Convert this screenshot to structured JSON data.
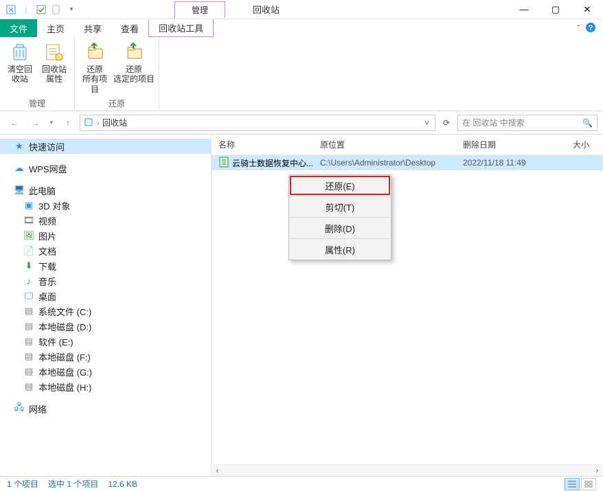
{
  "titlebar": {
    "contextual_label": "管理",
    "window_title": "回收站"
  },
  "tabs": {
    "file": "文件",
    "home": "主页",
    "share": "共享",
    "view": "查看",
    "contextual": "回收站工具"
  },
  "ribbon": {
    "group_manage": "管理",
    "group_restore": "还原",
    "empty_bin": "清空回\n收站",
    "properties": "回收站\n属性",
    "restore_all": "还原\n所有项目",
    "restore_selected": "还原\n选定的项目"
  },
  "address": {
    "location": "回收站"
  },
  "search": {
    "placeholder": "在 回收站 中搜索"
  },
  "columns": {
    "name": "名称",
    "original_location": "原位置",
    "deleted_date": "删除日期",
    "size": "大小"
  },
  "items": [
    {
      "name": "云骑士数据恢复中心...",
      "original_location": "C:\\Users\\Administrator\\Desktop",
      "deleted_date": "2022/11/18 11:49"
    }
  ],
  "context_menu": {
    "restore": "还原(E)",
    "cut": "剪切(T)",
    "delete": "删除(D)",
    "properties": "属性(R)"
  },
  "nav": {
    "quick_access": "快速访问",
    "wps_cloud": "WPS网盘",
    "this_pc": "此电脑",
    "objects_3d": "3D 对象",
    "videos": "视频",
    "pictures": "图片",
    "documents": "文档",
    "downloads": "下载",
    "music": "音乐",
    "desktop": "桌面",
    "sysdrive_c": "系统文件 (C:)",
    "disk_d": "本地磁盘 (D:)",
    "disk_e": "软件 (E:)",
    "disk_f": "本地磁盘 (F:)",
    "disk_g": "本地磁盘 (G:)",
    "disk_h": "本地磁盘 (H:)",
    "network": "网络"
  },
  "status": {
    "item_count": "1 个项目",
    "selection": "选中 1 个项目",
    "size": "12.6 KB"
  }
}
